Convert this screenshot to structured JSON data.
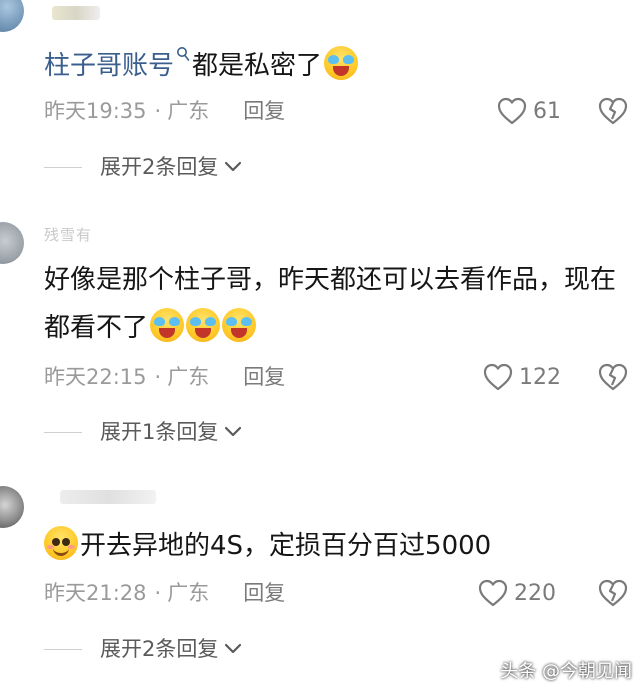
{
  "comments": [
    {
      "mention": "柱子哥账号",
      "text": "都是私密了",
      "emoji": [
        "cry-laugh-emoji"
      ],
      "time": "昨天19:35",
      "location": "广东",
      "reply_label": "回复",
      "likes": "61",
      "expand_label": "展开2条回复"
    },
    {
      "username": "残雪有",
      "text": "好像是那个柱子哥，昨天都还可以去看作品，现在都看不了",
      "emoji": [
        "cry-laugh-emoji",
        "cry-laugh-emoji",
        "cry-laugh-emoji"
      ],
      "time": "昨天22:15",
      "location": "广东",
      "reply_label": "回复",
      "likes": "122",
      "expand_label": "展开1条回复"
    },
    {
      "text": "开去异地的4S，定损百分百过5000",
      "emoji": [
        "smile-emoji"
      ],
      "time": "昨天21:28",
      "location": "广东",
      "reply_label": "回复",
      "likes": "220",
      "expand_label": "展开2条回复"
    }
  ],
  "separator": "·",
  "watermark": "头条 @今朝见闻",
  "colors": {
    "mention": "#3a5f8e",
    "meta": "#9a9a9a",
    "text": "#161616"
  }
}
